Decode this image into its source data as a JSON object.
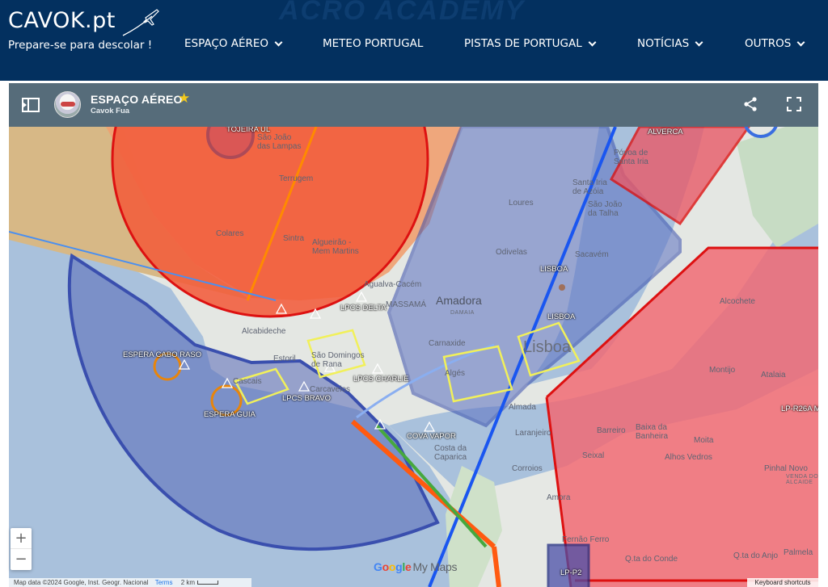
{
  "site": {
    "logo_title": "CAVOK.pt",
    "logo_tagline": "Prepare-se para descolar !",
    "banner_text": "ACRO ACADEMY",
    "nav": [
      {
        "label": "ESPAÇO AÉREO",
        "has_dropdown": true
      },
      {
        "label": "METEO PORTUGAL",
        "has_dropdown": false
      },
      {
        "label": "PISTAS DE PORTUGAL",
        "has_dropdown": true
      },
      {
        "label": "NOTÍCIAS",
        "has_dropdown": true
      },
      {
        "label": "OUTROS",
        "has_dropdown": true
      }
    ],
    "header_color": "#03305f"
  },
  "map": {
    "title": "ESPAÇO AÉREO",
    "subtitle": "Cavok Fua",
    "toolbar_color": "#566c7a",
    "zoom_in": "+",
    "zoom_out": "−",
    "google_logo": [
      "G",
      "o",
      "o",
      "g",
      "l",
      "e"
    ],
    "my_maps": "My Maps",
    "attribution": "Map data ©2024 Google, Inst. Geogr. Nacional",
    "terms": "Terms",
    "scale_label": "2 km",
    "keyboard_shortcuts": "Keyboard shortcuts",
    "zone_labels": {
      "toojira": "TOJEIRA UL",
      "alverca": "ALVERCA",
      "lisboa1": "LISBOA",
      "lisboa2": "LISBOA",
      "lpcs_delta": "LPCS DELTA",
      "espera_cabo_raso": "ESPERA CABO RASO",
      "lpcs_charlie": "LPCS CHARLIE",
      "lpcs_bravo": "LPCS BRAVO",
      "espera_guia": "ESPERA GUIA",
      "cova_vapor": "COVA VAPOR",
      "lp_r26a": "LP-R26A M",
      "lp_p2": "LP-P2"
    },
    "places": {
      "sao_joao": "São João\ndas Lampas",
      "terrugem": "Terrugem",
      "colares": "Colares",
      "sintra": "Sintra",
      "algueirao": "Algueirão -\nMem Martins",
      "loures": "Loures",
      "santa_iria": "Santa Iria\nde Azóia",
      "sao_joao_talha": "São João\nda Talha",
      "povoa": "Póvoa de\nSanta Iria",
      "odivelas": "Odivelas",
      "sacavem": "Sacavém",
      "queluz": "Agualva-Cacém",
      "amadora": "Amadora",
      "damaia": "DAMAIA",
      "massama": "MASSAMÁ",
      "alcabideche": "Alcabideche",
      "estoril": "Estoril",
      "sao_domingos": "São Domingos\nde Rana",
      "cascais": "Cascais",
      "carcavelos": "Carcavelos",
      "carnaxide": "Carnaxide",
      "alges": "Algés",
      "lisboa_city": "Lisboa",
      "almada": "Almada",
      "laranjeiro": "Laranjeiro",
      "costa": "Costa da\nCaparica",
      "corroios": "Corroios",
      "amora": "Amora",
      "fernao_ferro": "Fernão Ferro",
      "qta_conde": "Q.ta do Conde",
      "qta_anjo": "Q.ta do Anjo",
      "palmela": "Palmela",
      "alcochete": "Alcochete",
      "montijo": "Montijo",
      "atalaia": "Atalaia",
      "barreiro": "Barreiro",
      "baixa_banheira": "Baixa da\nBanheira",
      "moita": "Moita",
      "alhos_vedros": "Alhos Vedros",
      "seixal": "Seixal",
      "pinhal_novo": "Pinhal Novo",
      "venda": "VENDA DO\nALCAIDE"
    }
  }
}
